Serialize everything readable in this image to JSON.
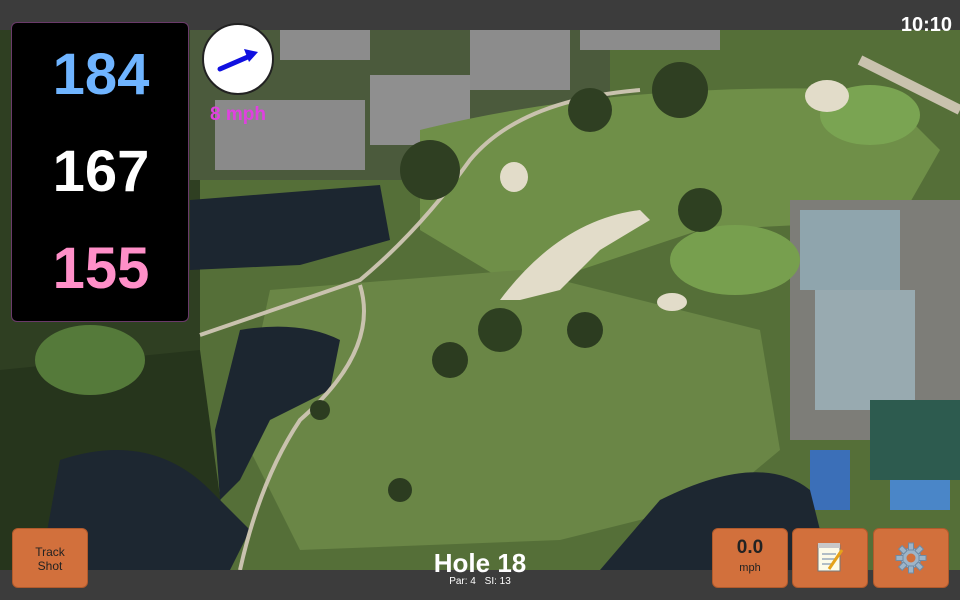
{
  "status_bar": {
    "time": "10:10"
  },
  "distances": {
    "back": "184",
    "middle": "167",
    "front": "155"
  },
  "wind": {
    "speed_label": "8 mph",
    "arrow_icon": "wind-direction-arrow-icon"
  },
  "hole": {
    "title": "Hole 18",
    "par": "Par: 4",
    "si": "SI: 13"
  },
  "buttons": {
    "track_shot_line1": "Track",
    "track_shot_line2": "Shot",
    "wind_value": "0.0",
    "wind_unit": "mph",
    "notes_icon": "notepad-icon",
    "settings_icon": "gear-icon"
  },
  "colors": {
    "back_distance": "#6fb4ff",
    "middle_distance": "#ffffff",
    "front_distance": "#ff8fc8",
    "wind_speed": "#e040e0",
    "button": "#d2703c"
  }
}
